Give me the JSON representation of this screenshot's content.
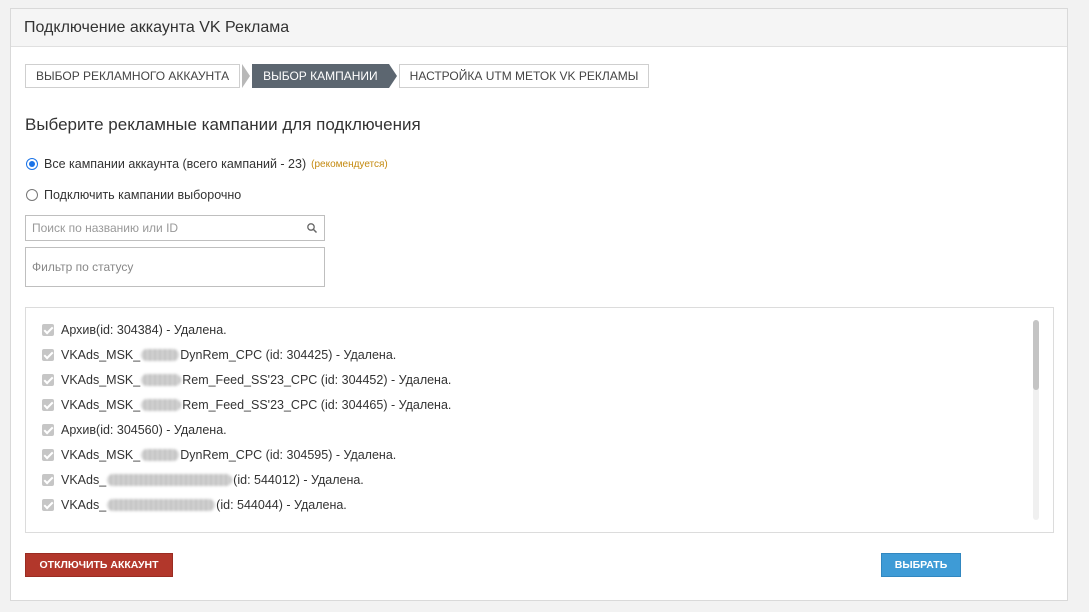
{
  "panel": {
    "title": "Подключение аккаунта VK Реклама"
  },
  "steps": [
    {
      "label": "Выбор рекламного аккаунта",
      "active": false
    },
    {
      "label": "Выбор кампании",
      "active": true
    },
    {
      "label": "Настройка UTM меток VK Рекламы",
      "active": false
    }
  ],
  "section_title": "Выберите рекламные кампании для подключения",
  "options": {
    "all": {
      "label": "Все кампании аккаунта (всего кампаний - 23)",
      "note": "(рекомендуется)",
      "checked": true
    },
    "selective": {
      "label": "Подключить кампании выборочно",
      "checked": false
    }
  },
  "search": {
    "placeholder": "Поиск по названию или ID",
    "value": ""
  },
  "filter": {
    "placeholder": "Фильтр по статусу"
  },
  "campaigns": [
    {
      "prefix": "Архив",
      "suffix": " (id: 304384) - Удалена."
    },
    {
      "prefix": "VKAds_MSK_",
      "suffix": "DynRem_CPC (id: 304425) - Удалена."
    },
    {
      "prefix": "VKAds_MSK_",
      "suffix": "Rem_Feed_SS'23_CPC (id: 304452) - Удалена."
    },
    {
      "prefix": "VKAds_MSK_",
      "suffix": "Rem_Feed_SS'23_CPC (id: 304465) - Удалена."
    },
    {
      "prefix": "Архив",
      "suffix": " (id: 304560) - Удалена."
    },
    {
      "prefix": "VKAds_MSK_",
      "suffix": "DynRem_CPC (id: 304595) - Удалена."
    },
    {
      "prefix": "VKAds_",
      "suffix": "(id: 544012) - Удалена."
    },
    {
      "prefix": "VKAds_",
      "suffix": "(id: 544044) - Удалена."
    }
  ],
  "buttons": {
    "disconnect": "Отключить аккаунт",
    "select": "Выбрать"
  },
  "icons": {
    "search": "search-icon"
  },
  "colors": {
    "active_step": "#5c6670",
    "disconnect_button": "#b2372b",
    "select_button": "#3e9bd6",
    "recommended_note": "#c48a10",
    "radio_accent": "#1a73e8"
  }
}
